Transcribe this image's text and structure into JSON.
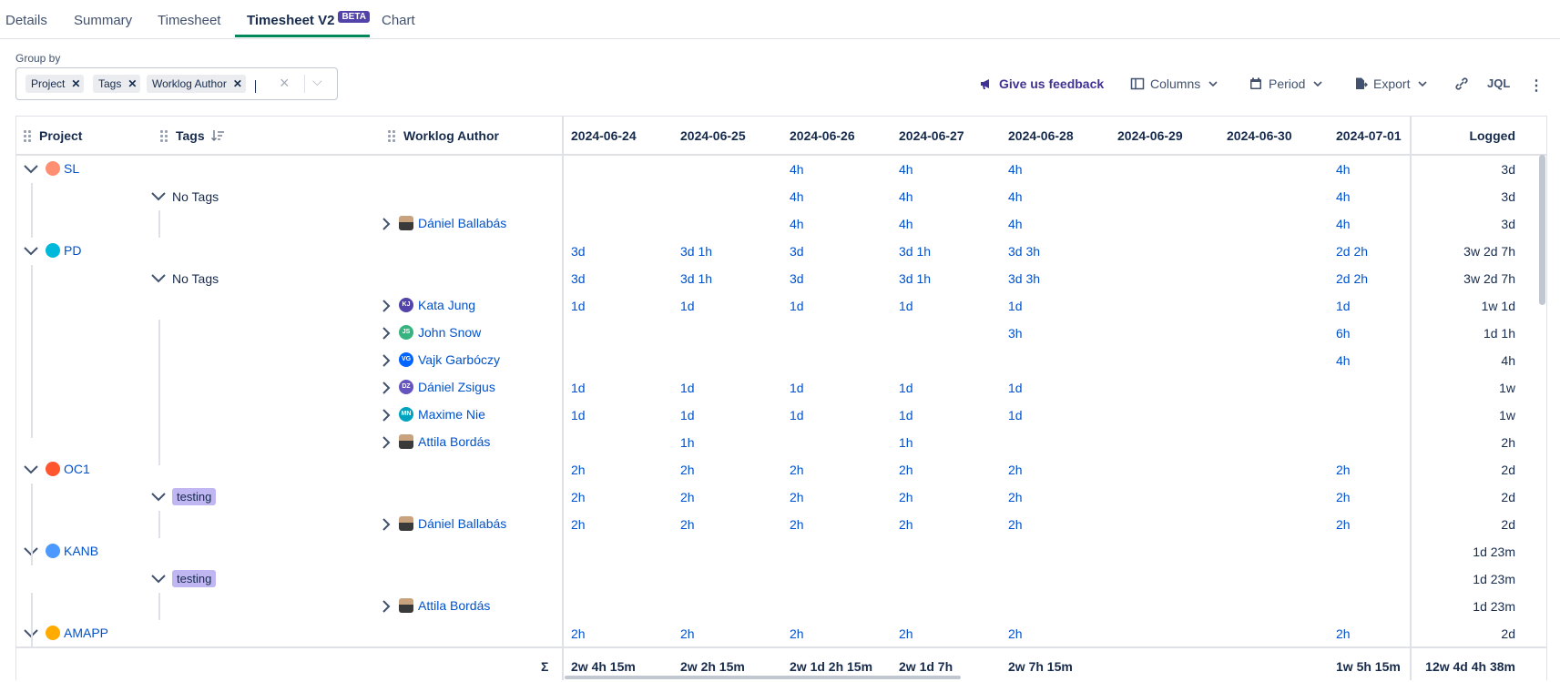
{
  "tabs": [
    {
      "label": "Details"
    },
    {
      "label": "Summary"
    },
    {
      "label": "Timesheet"
    },
    {
      "label": "Timesheet V2",
      "badge": "BETA"
    },
    {
      "label": "Chart"
    }
  ],
  "group_by": {
    "label": "Group by",
    "chips": [
      "Project",
      "Tags",
      "Worklog Author"
    ]
  },
  "toolbar": {
    "feedback": "Give us feedback",
    "columns": "Columns",
    "period": "Period",
    "export": "Export",
    "jql": "JQL"
  },
  "columns": {
    "project": "Project",
    "tags": "Tags",
    "author": "Worklog Author",
    "dates": [
      "2024-06-24",
      "2024-06-25",
      "2024-06-26",
      "2024-06-27",
      "2024-06-28",
      "2024-06-29",
      "2024-06-30",
      "2024-07-01"
    ],
    "logged": "Logged"
  },
  "rows": [
    {
      "level": 0,
      "name": "SL",
      "values": [
        "",
        "",
        "4h",
        "4h",
        "4h",
        "",
        "",
        "4h"
      ],
      "logged": "3d"
    },
    {
      "level": 1,
      "name": "No Tags",
      "values": [
        "",
        "",
        "4h",
        "4h",
        "4h",
        "",
        "",
        "4h"
      ],
      "logged": "3d"
    },
    {
      "level": 2,
      "name": "Dániel Ballabás",
      "values": [
        "",
        "",
        "4h",
        "4h",
        "4h",
        "",
        "",
        "4h"
      ],
      "logged": "3d"
    },
    {
      "level": 0,
      "name": "PD",
      "values": [
        "3d",
        "3d 1h",
        "3d",
        "3d 1h",
        "3d 3h",
        "",
        "",
        "2d 2h"
      ],
      "logged": "3w 2d 7h"
    },
    {
      "level": 1,
      "name": "No Tags",
      "values": [
        "3d",
        "3d 1h",
        "3d",
        "3d 1h",
        "3d 3h",
        "",
        "",
        "2d 2h"
      ],
      "logged": "3w 2d 7h"
    },
    {
      "level": 2,
      "name": "Kata Jung",
      "initials": "KJ",
      "values": [
        "1d",
        "1d",
        "1d",
        "1d",
        "1d",
        "",
        "",
        "1d"
      ],
      "logged": "1w 1d"
    },
    {
      "level": 2,
      "name": "John Snow",
      "initials": "JS",
      "values": [
        "",
        "",
        "",
        "",
        "3h",
        "",
        "",
        "6h"
      ],
      "logged": "1d 1h"
    },
    {
      "level": 2,
      "name": "Vajk Garbóczy",
      "initials": "VG",
      "values": [
        "",
        "",
        "",
        "",
        "",
        "",
        "",
        "4h"
      ],
      "logged": "4h"
    },
    {
      "level": 2,
      "name": "Dániel Zsigus",
      "initials": "DZ",
      "values": [
        "1d",
        "1d",
        "1d",
        "1d",
        "1d",
        "",
        "",
        ""
      ],
      "logged": "1w"
    },
    {
      "level": 2,
      "name": "Maxime Nie",
      "initials": "MN",
      "values": [
        "1d",
        "1d",
        "1d",
        "1d",
        "1d",
        "",
        "",
        ""
      ],
      "logged": "1w"
    },
    {
      "level": 2,
      "name": "Attila Bordás",
      "values": [
        "",
        "1h",
        "",
        "1h",
        "",
        "",
        "",
        ""
      ],
      "logged": "2h"
    },
    {
      "level": 0,
      "name": "OC1",
      "values": [
        "2h",
        "2h",
        "2h",
        "2h",
        "2h",
        "",
        "",
        "2h"
      ],
      "logged": "2d"
    },
    {
      "level": 1,
      "name": "testing",
      "badge": true,
      "values": [
        "2h",
        "2h",
        "2h",
        "2h",
        "2h",
        "",
        "",
        "2h"
      ],
      "logged": "2d"
    },
    {
      "level": 2,
      "name": "Dániel Ballabás",
      "values": [
        "2h",
        "2h",
        "2h",
        "2h",
        "2h",
        "",
        "",
        "2h"
      ],
      "logged": "2d"
    },
    {
      "level": 0,
      "name": "KANB",
      "values": [
        "",
        "",
        "",
        "",
        "",
        "",
        "",
        ""
      ],
      "logged": "1d 23m"
    },
    {
      "level": 1,
      "name": "testing",
      "badge": true,
      "values": [
        "",
        "",
        "",
        "",
        "",
        "",
        "",
        ""
      ],
      "logged": "1d 23m"
    },
    {
      "level": 2,
      "name": "Attila Bordás",
      "values": [
        "",
        "",
        "",
        "",
        "",
        "",
        "",
        ""
      ],
      "logged": "1d 23m"
    },
    {
      "level": 0,
      "name": "AMAPP",
      "values": [
        "2h",
        "2h",
        "2h",
        "2h",
        "2h",
        "",
        "",
        "2h"
      ],
      "logged": "2d"
    }
  ],
  "footer": {
    "sigma": "Σ",
    "totals": [
      "2w 4h 15m",
      "2w 2h 15m",
      "2w 1d 2h 15m",
      "2w 1d 7h",
      "2w 7h 15m",
      "",
      "",
      "1w 5h 15m"
    ],
    "logged": "12w 4d 4h 38m"
  },
  "colors": {
    "accent": "#0052cc",
    "tab_active": "#00875a",
    "beta": "#5243aa",
    "tag_badge": "#c0b6f2"
  }
}
